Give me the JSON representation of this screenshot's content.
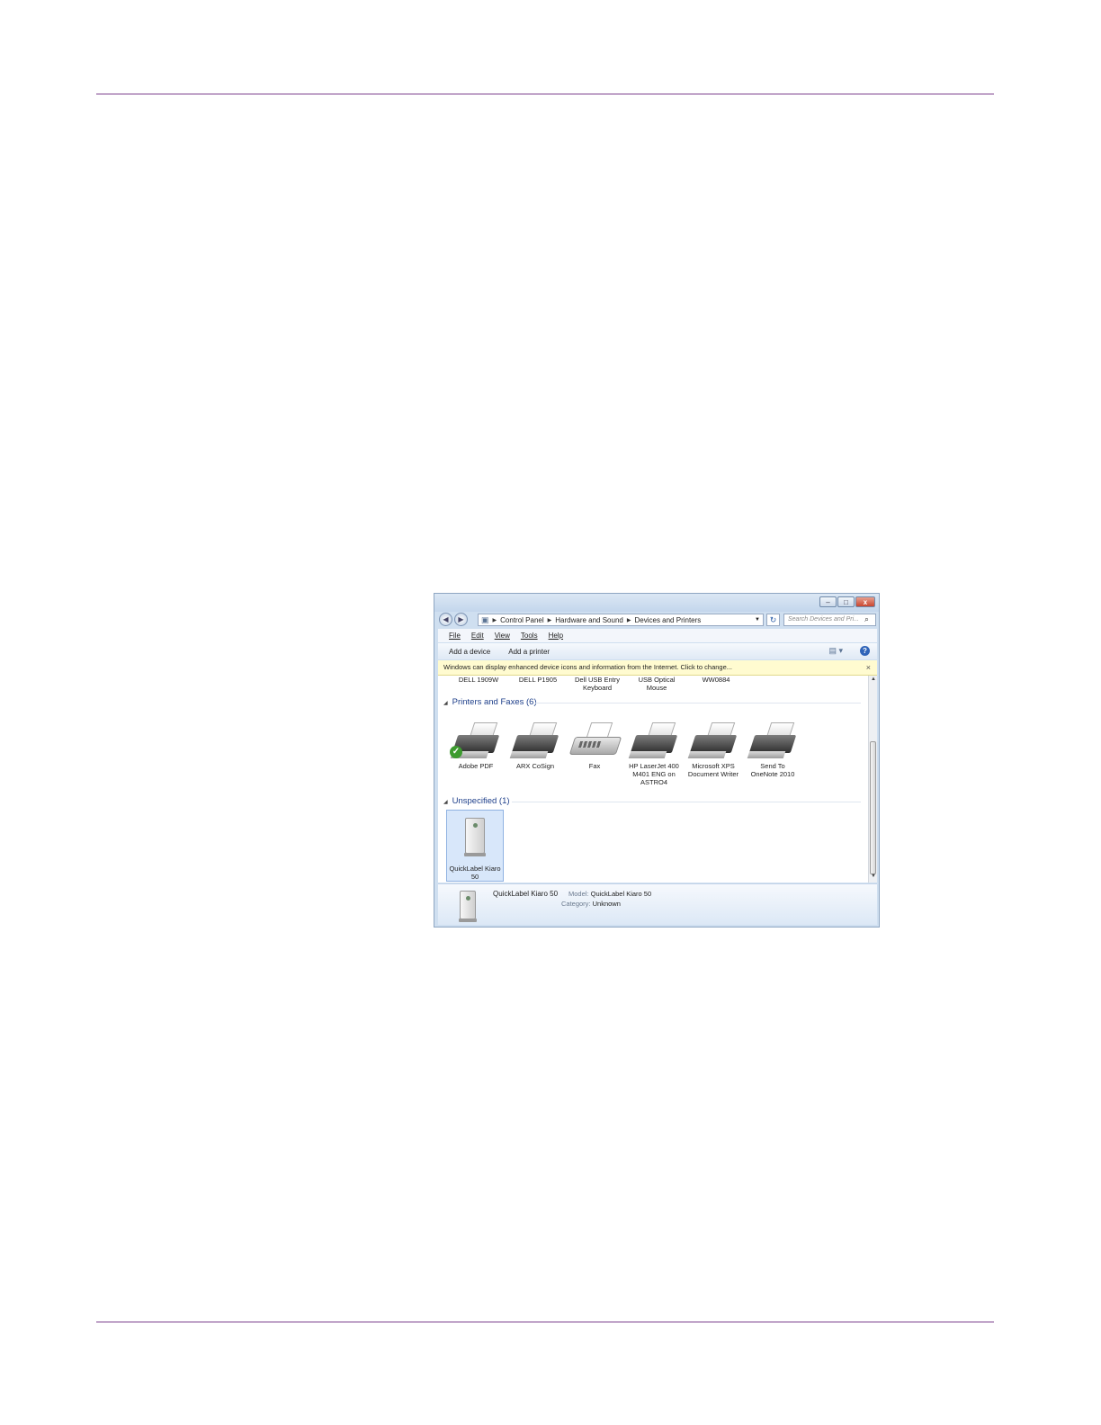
{
  "window": {
    "controls": {
      "minimize": "–",
      "maximize": "□",
      "close": "x"
    },
    "nav": {
      "back": "◀",
      "forward": "▶"
    },
    "breadcrumb": [
      "Control Panel",
      "Hardware and Sound",
      "Devices and Printers"
    ],
    "search_placeholder": "Search Devices and Pri...",
    "menu": [
      "File",
      "Edit",
      "View",
      "Tools",
      "Help"
    ],
    "commands": {
      "add_device": "Add a device",
      "add_printer": "Add a printer"
    },
    "infobar": {
      "text": "Windows can display enhanced device icons and information from the Internet. Click to change...",
      "close": "×"
    },
    "top_devices": [
      {
        "line1": "DELL 1909W",
        "line2": ""
      },
      {
        "line1": "DELL P1905",
        "line2": ""
      },
      {
        "line1": "Dell USB Entry",
        "line2": "Keyboard"
      },
      {
        "line1": "USB Optical",
        "line2": "Mouse"
      },
      {
        "line1": "WW0884",
        "line2": ""
      }
    ],
    "groups": {
      "printers": {
        "title": "Printers and Faxes (6)",
        "items": [
          {
            "l1": "Adobe PDF",
            "l2": "",
            "l3": ""
          },
          {
            "l1": "ARX CoSign",
            "l2": "",
            "l3": ""
          },
          {
            "l1": "Fax",
            "l2": "",
            "l3": ""
          },
          {
            "l1": "HP LaserJet 400",
            "l2": "M401 ENG on",
            "l3": "ASTRO4"
          },
          {
            "l1": "Microsoft XPS",
            "l2": "Document Writer",
            "l3": ""
          },
          {
            "l1": "Send To",
            "l2": "OneNote 2010",
            "l3": ""
          }
        ]
      },
      "unspecified": {
        "title": "Unspecified (1)",
        "items": [
          {
            "l1": "QuickLabel Kiaro",
            "l2": "50"
          }
        ]
      }
    },
    "details": {
      "name": "QuickLabel Kiaro 50",
      "model_label": "Model:",
      "model_value": "QuickLabel Kiaro 50",
      "category_label": "Category:",
      "category_value": "Unknown"
    }
  }
}
